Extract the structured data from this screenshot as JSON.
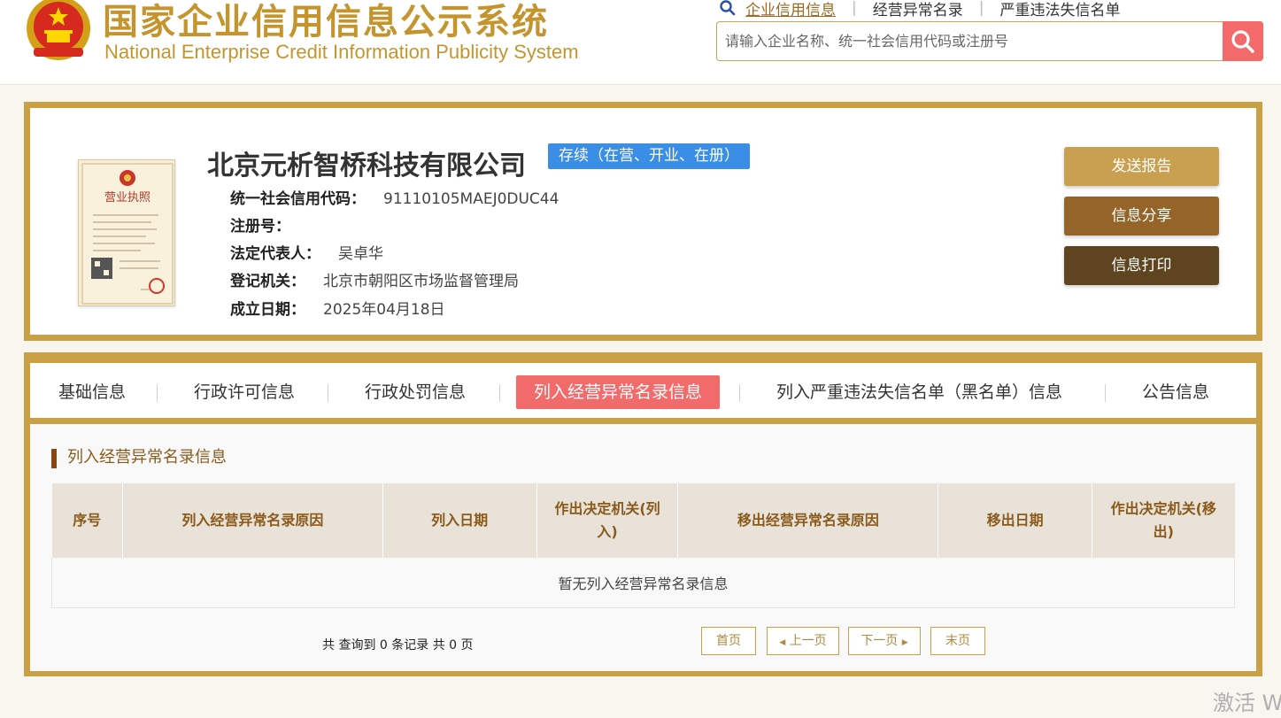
{
  "header": {
    "title_cn": "国家企业信用信息公示系统",
    "title_en": "National Enterprise Credit Information Publicity System",
    "nav": [
      {
        "label": "企业信用信息",
        "active": true
      },
      {
        "label": "经营异常名录",
        "active": false
      },
      {
        "label": "严重违法失信名单",
        "active": false
      }
    ],
    "search": {
      "placeholder": "请输入企业名称、统一社会信用代码或注册号",
      "value": ""
    }
  },
  "company": {
    "name": "北京元析智桥科技有限公司",
    "status": "存续（在营、开业、在册）",
    "license_image_title": "营业执照",
    "fields": [
      {
        "key": "统一社会信用代码：",
        "value": "91110105MAEJ0DUC44"
      },
      {
        "key": "注册号：",
        "value": ""
      },
      {
        "key": "法定代表人：",
        "value": "吴卓华"
      },
      {
        "key": "登记机关：",
        "value": "北京市朝阳区市场监督管理局"
      },
      {
        "key": "成立日期：",
        "value": "2025年04月18日"
      }
    ],
    "actions": {
      "send_report": "发送报告",
      "share": "信息分享",
      "print": "信息打印"
    }
  },
  "tabs": [
    {
      "label": "基础信息",
      "active": false
    },
    {
      "label": "行政许可信息",
      "active": false
    },
    {
      "label": "行政处罚信息",
      "active": false
    },
    {
      "label": "列入经营异常名录信息",
      "active": true
    },
    {
      "label": "列入严重违法失信名单（黑名单）信息",
      "active": false
    },
    {
      "label": "公告信息",
      "active": false
    }
  ],
  "section": {
    "title": "列入经营异常名录信息",
    "columns": [
      "序号",
      "列入经营异常名录原因",
      "列入日期",
      "作出决定机关(列入)",
      "移出经营异常名录原因",
      "移出日期",
      "作出决定机关(移出)"
    ],
    "empty_message": "暂无列入经营异常名录信息"
  },
  "pager": {
    "summary": "共 查询到 0 条记录 共 0 页",
    "first": "首页",
    "prev": "上一页",
    "next": "下一页",
    "last": "末页"
  },
  "watermark": "激活 W",
  "colors": {
    "gold_border": "#c9a046",
    "active_tab": "#f26b6b",
    "status_blue": "#3a8ee6",
    "btn_send": "#c9a050",
    "btn_share": "#956428",
    "btn_print": "#5e4520",
    "header_text": "#8b5a1a"
  }
}
